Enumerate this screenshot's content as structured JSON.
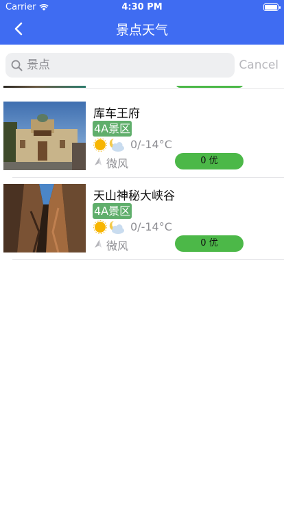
{
  "status_bar": {
    "carrier": "Carrier",
    "time": "4:30 PM"
  },
  "nav": {
    "title": "景点天气",
    "back_icon": "chevron-left-icon"
  },
  "search": {
    "placeholder": "景点",
    "value": "",
    "cancel_label": "Cancel"
  },
  "spots": [
    {
      "name": "库车王府",
      "level": "4A景区",
      "weather_icon": "sunny-to-cloudy-night-icon",
      "temperature": "0/-14°C",
      "wind": "微风",
      "aqi": "0 优"
    },
    {
      "name": "天山神秘大峡谷",
      "level": "4A景区",
      "weather_icon": "sunny-to-cloudy-night-icon",
      "temperature": "0/-14°C",
      "wind": "微风",
      "aqi": "0 优"
    }
  ],
  "colors": {
    "nav_blue": "#3f6cf2",
    "aqi_green": "#4cb848",
    "level_green": "#5fae6b",
    "secondary_text": "#8e8e93"
  }
}
